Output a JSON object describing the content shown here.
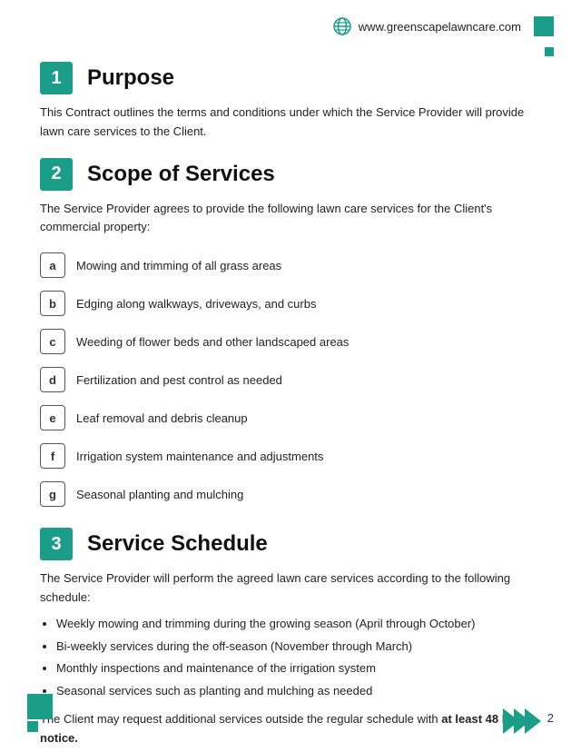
{
  "header": {
    "website": "www.greenscapelawncare.com"
  },
  "sections": [
    {
      "number": "1",
      "title": "Purpose",
      "body": "This Contract outlines the terms and conditions under which the Service Provider will provide lawn care services to the Client."
    },
    {
      "number": "2",
      "title": "Scope of Services",
      "intro": "The Service Provider agrees to provide the following lawn care services for the Client's commercial property:",
      "items": [
        {
          "letter": "a",
          "text": "Mowing and trimming of all grass areas"
        },
        {
          "letter": "b",
          "text": "Edging along walkways, driveways, and curbs"
        },
        {
          "letter": "c",
          "text": "Weeding of flower beds and other landscaped areas"
        },
        {
          "letter": "d",
          "text": "Fertilization and pest control as needed"
        },
        {
          "letter": "e",
          "text": "Leaf removal and debris cleanup"
        },
        {
          "letter": "f",
          "text": "Irrigation system maintenance and adjustments"
        },
        {
          "letter": "g",
          "text": "Seasonal planting and mulching"
        }
      ]
    },
    {
      "number": "3",
      "title": "Service Schedule",
      "intro": "The Service Provider will perform the agreed lawn care services according to the following schedule:",
      "bullets": [
        "Weekly mowing and trimming during the growing season (April through October)",
        "Bi-weekly services during the off-season (November through March)",
        "Monthly inspections and maintenance of the irrigation system",
        "Seasonal services such as planting and mulching as needed"
      ],
      "notice": "The Client may request additional services outside the regular schedule with ",
      "notice_bold": "at least 48 hours notice."
    }
  ],
  "footer": {
    "page_number": "2"
  }
}
